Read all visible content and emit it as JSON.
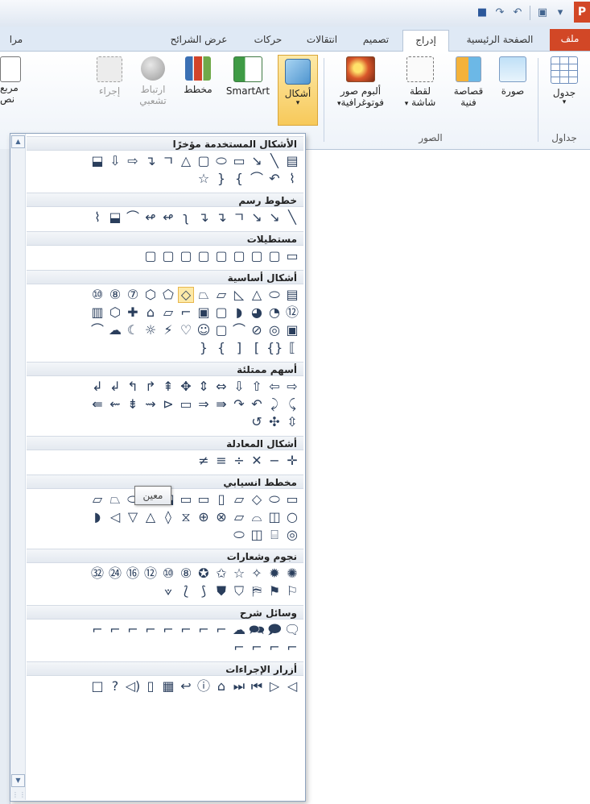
{
  "app": {
    "logo_letter": "P",
    "accent": "#d24726",
    "ribbon_bg": "#eef3f9"
  },
  "qat": {
    "icons": [
      "save-icon",
      "undo-icon",
      "redo-icon",
      "slideshow-icon",
      "customize-icon"
    ],
    "glyphs": [
      "▾",
      "⎘",
      "↶",
      "↷",
      "💾"
    ]
  },
  "tabs": {
    "file": "ملف",
    "home": "الصفحة الرئيسية",
    "insert": "إدراج",
    "design": "تصميم",
    "transitions": "انتقالات",
    "animations": "حركات",
    "slideshow": "عرض الشرائح",
    "review": "مرا"
  },
  "ribbon": {
    "table": "جدول",
    "tables_group": "جداول",
    "picture": "صورة",
    "clipart_line1": "قصاصة",
    "clipart_line2": "فنية",
    "screenshot_line1": "لقطة",
    "screenshot_line2": "شاشة",
    "album_line1": "ألبوم صور",
    "album_line2": "فوتوغرافية",
    "images_group": "الصور",
    "shapes": "أشكال",
    "smartart": "SmartArt",
    "chart": "مخطط",
    "hyperlink_line1": "ارتباط",
    "hyperlink_line2": "تشعبي",
    "action": "إجراء",
    "textbox_line1": "مربع",
    "textbox_line2": "نص",
    "dropdown_arrow": "▾"
  },
  "gallery": {
    "tooltip": "معين",
    "scroll_up": "▲",
    "scroll_down": "▼",
    "grip": "⋮⋮",
    "categories": [
      {
        "title": "الأشكال المستخدمة مؤخرًا",
        "rows": [
          [
            "▤",
            "╲",
            "↘",
            "▭",
            "⬭",
            "▢",
            "△",
            "ㄱ",
            "↴",
            "⇨",
            "⇩",
            "⬓"
          ],
          [
            "⌇",
            "↶",
            "⌒",
            "{",
            "}",
            "☆"
          ]
        ]
      },
      {
        "title": "خطوط رسم",
        "rows": [
          [
            "╲",
            "↘",
            "↘",
            "ㄱ",
            "↴",
            "↴",
            "ʅ",
            "↫",
            "↫",
            "⌒",
            "⬓",
            "⌇"
          ]
        ]
      },
      {
        "title": "مستطيلات",
        "rows": [
          [
            "▭",
            "▢",
            "▢",
            "▢",
            "▢",
            "▢",
            "▢",
            "▢",
            "▢"
          ]
        ]
      },
      {
        "title": "أشكال أساسية",
        "rows": [
          [
            "▤",
            "⬭",
            "△",
            "◺",
            "▱",
            "⏢",
            "◇",
            "⬠",
            "⬡",
            "⑦",
            "⑧",
            "⑩"
          ],
          [
            "⑫",
            "◔",
            "◕",
            "◗",
            "▢",
            "▣",
            "⌐",
            "⏥",
            "⌂",
            "✚",
            "⬡",
            "▥"
          ],
          [
            "▣",
            "◎",
            "⊘",
            "⌒",
            "▢",
            "☺",
            "♡",
            "⚡",
            "☼",
            "☾",
            "☁",
            "⌒"
          ],
          [
            "⟦",
            "{}",
            "[",
            "]",
            "{",
            "}"
          ]
        ]
      },
      {
        "title": "أسهم ممتلئة",
        "rows": [
          [
            "⇨",
            "⇦",
            "⇧",
            "⇩",
            "⇔",
            "⇕",
            "✥",
            "⇞",
            "↱",
            "↰",
            "↲",
            "↲"
          ],
          [
            "⤹",
            "⤸",
            "↶",
            "↷",
            "⇛",
            "⇒",
            "▭",
            "⊳",
            "⇝",
            "⇟",
            "⇜",
            "⇚"
          ],
          [
            "⇳",
            "✣",
            "↺"
          ]
        ]
      },
      {
        "title": "أشكال المعادلة",
        "rows": [
          [
            "✛",
            "−",
            "✕",
            "÷",
            "≡",
            "≠"
          ]
        ]
      },
      {
        "title": "مخطط انسيابي",
        "rows": [
          [
            "▭",
            "⬭",
            "◇",
            "▱",
            "▯",
            "▭",
            "▭",
            "⬓",
            "⬬",
            "⬭",
            "⏢",
            "⏥"
          ],
          [
            "○",
            "◫",
            "⌓",
            "▱",
            "⊗",
            "⊕",
            "⧖",
            "◊",
            "△",
            "▽",
            "◁",
            "◗"
          ],
          [
            "◎",
            "⌸",
            "◫",
            "⬭"
          ]
        ]
      },
      {
        "title": "نجوم وشعارات",
        "rows": [
          [
            "✺",
            "✹",
            "✧",
            "☆",
            "✩",
            "✪",
            "⑧",
            "⑩",
            "⑫",
            "⑯",
            "㉔",
            "㉜"
          ],
          [
            "⚐",
            "⚑",
            "⛿",
            "⛉",
            "⛊",
            "⟆",
            "⟅",
            "⟇"
          ]
        ]
      },
      {
        "title": "وسائل شرح",
        "rows": [
          [
            "🗨",
            "🗩",
            "🗪",
            "☁",
            "⌐",
            "⌐",
            "⌐",
            "⌐",
            "⌐",
            "⌐",
            "⌐",
            "⌐"
          ],
          [
            "⌐",
            "⌐",
            "⌐",
            "⌐"
          ]
        ]
      },
      {
        "title": "أزرار الإجراءات",
        "rows": [
          [
            "◁",
            "▷",
            "⏮",
            "⏭",
            "⌂",
            "ⓘ",
            "↩",
            "▦",
            "▯",
            "◁)",
            "?",
            "□"
          ]
        ]
      }
    ]
  }
}
